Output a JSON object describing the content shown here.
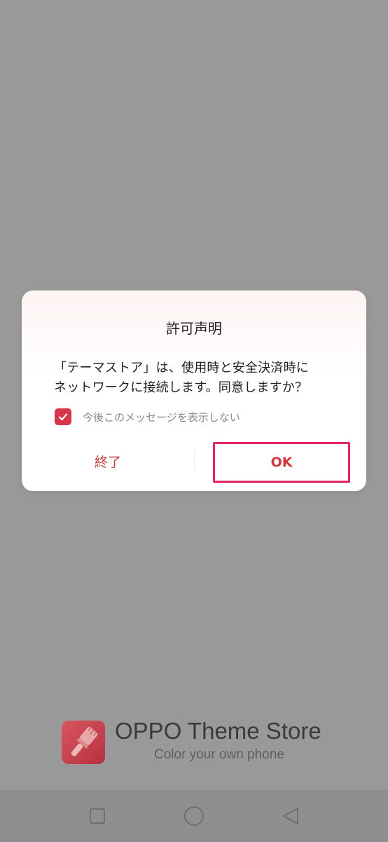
{
  "dialog": {
    "title": "許可声明",
    "message_line1": "「テーマストア」は、使用時と安全決済時に",
    "message_line2": "ネットワークに接続します。同意しますか？",
    "dont_show_label": "今後このメッセージを表示しない",
    "dont_show_checked": true,
    "cancel_label": "終了",
    "ok_label": "OK"
  },
  "branding": {
    "app_name": "OPPO Theme Store",
    "tagline": "Color your own phone",
    "logo_icon": "paintbrush-icon"
  },
  "navbar": {
    "buttons": [
      "recents-square-icon",
      "home-circle-icon",
      "back-triangle-icon"
    ]
  },
  "colors": {
    "accent": "#d6364a",
    "ok_highlight": "#e0245e",
    "background_overlay": "#999999"
  }
}
